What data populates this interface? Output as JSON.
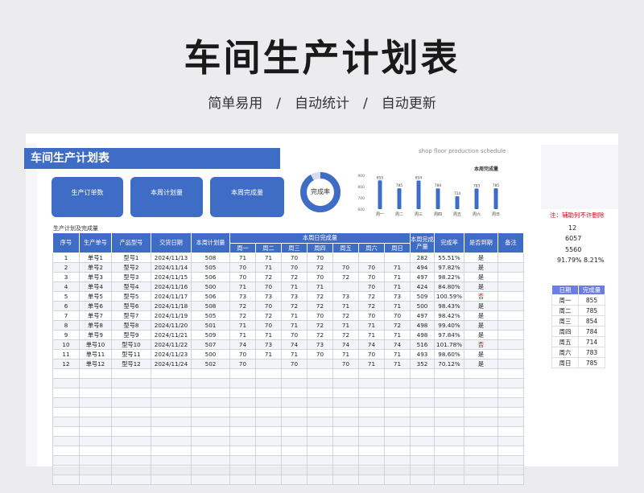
{
  "hero": {
    "title": "车间生产计划表",
    "subtitle": "简单易用　/　自动统计　/　自动更新"
  },
  "sheet": {
    "title": "车间生产计划表",
    "subtitle_en": "shop floor production schedule",
    "cards": [
      "生产订单数",
      "本周计划量",
      "本周完成量"
    ],
    "donut_label": "完成率",
    "table_caption": "生产计划及完成量",
    "note": "注：辅助列不许删除"
  },
  "chart_data": {
    "type": "bar",
    "title": "本周完成量",
    "categories": [
      "周一",
      "周二",
      "周三",
      "周四",
      "周五",
      "周六",
      "周日"
    ],
    "values": [
      855,
      785,
      854,
      784,
      714,
      783,
      785
    ],
    "yticks": [
      600,
      700,
      800,
      900
    ],
    "ylim": [
      600,
      900
    ],
    "color": "#3f6cc4"
  },
  "donut": {
    "value": 0.9179,
    "color": "#3f6cc4",
    "track": "#d6dcef"
  },
  "table": {
    "headers": {
      "seq": "序号",
      "order": "生产单号",
      "model": "产品型号",
      "date": "交货日期",
      "plan": "本周计划量",
      "daily_group": "本周日完成量",
      "total": "本周完成产量",
      "rate": "完成率",
      "due": "是否到期",
      "remark": "备注",
      "days": [
        "周一",
        "周二",
        "周三",
        "周四",
        "周五",
        "周六",
        "周日"
      ]
    },
    "rows": [
      [
        "1",
        "单号1",
        "型号1",
        "2024/11/13",
        "508",
        "71",
        "71",
        "70",
        "70",
        "",
        "",
        "",
        "282",
        "55.51%",
        "是"
      ],
      [
        "2",
        "单号2",
        "型号2",
        "2024/11/14",
        "505",
        "70",
        "71",
        "70",
        "72",
        "70",
        "70",
        "71",
        "494",
        "97.82%",
        "是"
      ],
      [
        "3",
        "单号3",
        "型号3",
        "2024/11/15",
        "506",
        "70",
        "72",
        "72",
        "70",
        "72",
        "70",
        "71",
        "497",
        "98.22%",
        "是"
      ],
      [
        "4",
        "单号4",
        "型号4",
        "2024/11/16",
        "500",
        "71",
        "70",
        "71",
        "71",
        "",
        "70",
        "71",
        "424",
        "84.80%",
        "是"
      ],
      [
        "5",
        "单号5",
        "型号5",
        "2024/11/17",
        "506",
        "73",
        "73",
        "73",
        "72",
        "73",
        "72",
        "73",
        "509",
        "100.59%",
        "否"
      ],
      [
        "6",
        "单号6",
        "型号6",
        "2024/11/18",
        "508",
        "72",
        "70",
        "72",
        "72",
        "71",
        "72",
        "71",
        "500",
        "98.43%",
        "是"
      ],
      [
        "7",
        "单号7",
        "型号7",
        "2024/11/19",
        "505",
        "72",
        "72",
        "71",
        "70",
        "72",
        "70",
        "70",
        "497",
        "98.42%",
        "是"
      ],
      [
        "8",
        "单号8",
        "型号8",
        "2024/11/20",
        "501",
        "71",
        "70",
        "71",
        "72",
        "71",
        "71",
        "72",
        "498",
        "99.40%",
        "是"
      ],
      [
        "9",
        "单号9",
        "型号9",
        "2024/11/21",
        "509",
        "71",
        "71",
        "70",
        "72",
        "72",
        "71",
        "71",
        "498",
        "97.84%",
        "是"
      ],
      [
        "10",
        "单号10",
        "型号10",
        "2024/11/22",
        "507",
        "74",
        "73",
        "74",
        "73",
        "74",
        "74",
        "74",
        "516",
        "101.78%",
        "否"
      ],
      [
        "11",
        "单号11",
        "型号11",
        "2024/11/23",
        "500",
        "70",
        "71",
        "71",
        "70",
        "71",
        "70",
        "71",
        "493",
        "98.60%",
        "是"
      ],
      [
        "12",
        "单号12",
        "型号12",
        "2024/11/24",
        "502",
        "70",
        "",
        "70",
        "",
        "70",
        "71",
        "71",
        "352",
        "70.12%",
        "是"
      ]
    ],
    "empty_rows": 12
  },
  "stats": {
    "orders": "12",
    "plan": "6057",
    "done": "5560",
    "rate_a": "91.79%",
    "rate_b": "8.21%"
  },
  "side_table": {
    "headers": [
      "日期",
      "完成量"
    ],
    "rows": [
      [
        "周一",
        "855"
      ],
      [
        "周二",
        "785"
      ],
      [
        "周三",
        "854"
      ],
      [
        "周四",
        "784"
      ],
      [
        "周五",
        "714"
      ],
      [
        "周六",
        "783"
      ],
      [
        "周日",
        "785"
      ]
    ]
  }
}
